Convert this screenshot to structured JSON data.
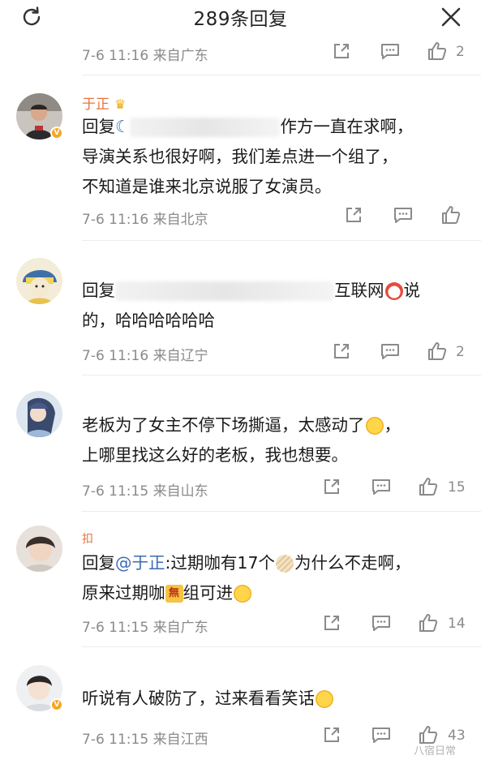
{
  "header": {
    "title": "289条回复",
    "refresh_icon": "refresh-icon",
    "close_icon": "close-icon"
  },
  "top_meta": {
    "time_location": "7-6 11:16 来自广东",
    "likes": "2"
  },
  "comments": [
    {
      "username": "于正",
      "badge_icon": "crown-icon",
      "lines": [
        "回复",
        "作方一直在求啊，",
        "导演关系也很好啊，我们差点进一个组了，",
        "不知道是谁来北京说服了女演员。"
      ],
      "time_location": "7-6 11:16 来自北京",
      "likes": ""
    },
    {
      "lines": [
        "回复",
        "互联网",
        "说",
        "的，哈哈哈哈哈哈"
      ],
      "time_location": "7-6 11:16 来自辽宁",
      "likes": "2"
    },
    {
      "lines": [
        "老板为了女主不停下场撕逼，太感动了",
        "，",
        "上哪里找这么好的老板，我也想要。"
      ],
      "time_location": "7-6 11:15 来自山东",
      "likes": "15"
    },
    {
      "username": "扣",
      "lines": [
        "回复",
        "@于正",
        ":过期咖有17个",
        "为什么不走啊，",
        "原来过期咖",
        "無",
        "组可进"
      ],
      "time_location": "7-6 11:15 来自广东",
      "likes": "14"
    },
    {
      "lines": [
        "听说有人破防了，过来看看笑话"
      ],
      "time_location": "7-6 11:15 来自江西",
      "likes": "43"
    }
  ],
  "watermark": "八宿日常",
  "colors": {
    "username": "#e8733a",
    "mention": "#3b6bb5",
    "meta": "#8a8a8a",
    "verified_badge": "#f5a623"
  }
}
